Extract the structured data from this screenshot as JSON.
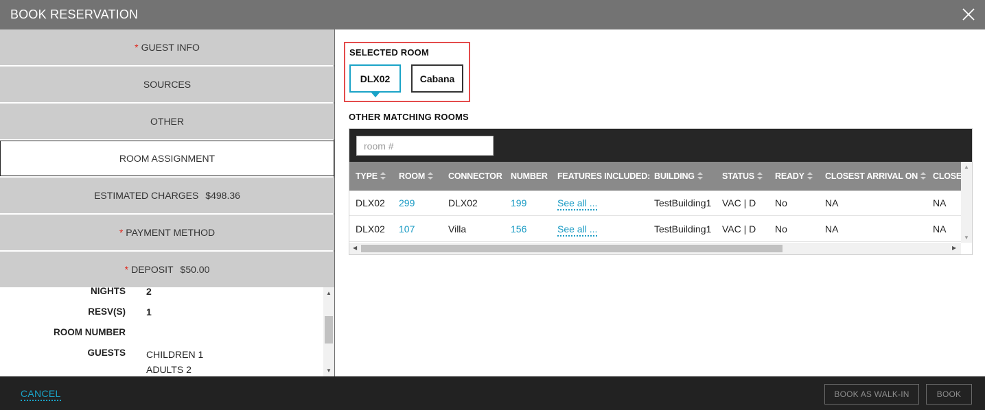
{
  "header": {
    "title": "BOOK RESERVATION"
  },
  "nav": {
    "guest_info": "GUEST INFO",
    "sources": "SOURCES",
    "other": "OTHER",
    "room_assignment": "ROOM ASSIGNMENT",
    "estimated_charges": "ESTIMATED CHARGES",
    "estimated_charges_amount": "$498.36",
    "payment_method": "PAYMENT METHOD",
    "deposit": "DEPOSIT",
    "deposit_amount": "$50.00",
    "required_marker": "*"
  },
  "summary": {
    "nights_label": "NIGHTS",
    "nights_value": "2",
    "resvs_label": "RESV(S)",
    "resvs_value": "1",
    "room_number_label": "ROOM NUMBER",
    "room_number_value": "",
    "guests_label": "GUESTS",
    "children": "CHILDREN 1",
    "adults": "ADULTS 2"
  },
  "selected_room": {
    "title": "SELECTED ROOM",
    "rooms": [
      "DLX02",
      "Cabana"
    ],
    "selected": "DLX02"
  },
  "other_matching": {
    "title": "OTHER MATCHING ROOMS",
    "search_placeholder": "room #",
    "columns": [
      "TYPE",
      "ROOM",
      "CONNECTOR",
      "NUMBER",
      "FEATURES INCLUDED:",
      "BUILDING",
      "STATUS",
      "READY",
      "CLOSEST ARRIVAL ON",
      "CLOSES"
    ],
    "rows": [
      {
        "type": "DLX02",
        "room": "299",
        "connector": "DLX02",
        "number": "199",
        "features": "See all ...",
        "building": "TestBuilding1",
        "status": "VAC | D",
        "ready": "No",
        "closest_arrival": "NA",
        "closest": "NA"
      },
      {
        "type": "DLX02",
        "room": "107",
        "connector": "Villa",
        "number": "156",
        "features": "See all ...",
        "building": "TestBuilding1",
        "status": "VAC | D",
        "ready": "No",
        "closest_arrival": "NA",
        "closest": "NA"
      }
    ]
  },
  "footer": {
    "cancel": "CANCEL",
    "book_walk_in": "BOOK AS WALK-IN",
    "book": "BOOK"
  },
  "colors": {
    "accent": "#1aa3c7",
    "required": "#e0261b",
    "highlight_border": "#e34b4b"
  }
}
